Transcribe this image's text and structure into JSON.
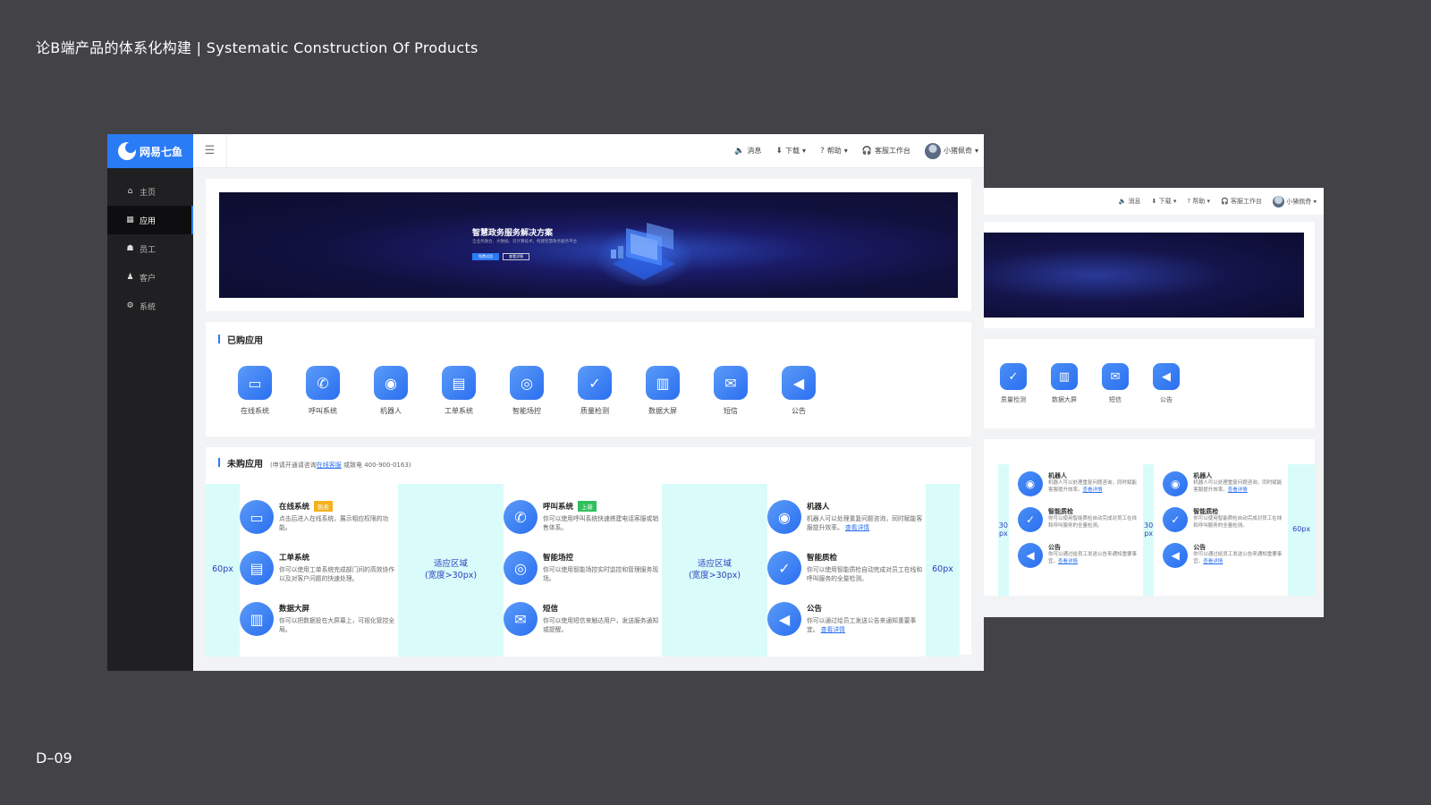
{
  "slide": {
    "title": "论B端产品的体系化构建 | Systematic Construction Of Products",
    "code": "D–09"
  },
  "colors": {
    "primary": "#2a7bf6",
    "sidebar": "#202022",
    "padding_zone": "#d9fcfa",
    "hot_badge": "#f5b21d",
    "new_badge": "#2fbf5b"
  },
  "app": {
    "logo": "网易七鱼",
    "sidebar": [
      {
        "label": "主页",
        "icon": "home-icon"
      },
      {
        "label": "应用",
        "icon": "grid-icon",
        "active": true
      },
      {
        "label": "员工",
        "icon": "team-icon"
      },
      {
        "label": "客户",
        "icon": "user-icon"
      },
      {
        "label": "系统",
        "icon": "gear-icon"
      }
    ],
    "topbar": {
      "message": "消息",
      "download": "下载",
      "help": "帮助",
      "workbench": "客服工作台",
      "username": "小猪佩奇"
    },
    "banner": {
      "title": "智慧政务服务解决方案",
      "subtitle": "全业务融合、大数据、云计算技术，构建智慧政务服务平台",
      "primary_button": "免费试用",
      "secondary_button": "查看详情"
    },
    "purchased": {
      "title": "已购应用",
      "apps": [
        {
          "label": "在线系统",
          "icon": "chat-icon"
        },
        {
          "label": "呼叫系统",
          "icon": "phone-icon"
        },
        {
          "label": "机器人",
          "icon": "robot-icon"
        },
        {
          "label": "工单系统",
          "icon": "ticket-icon"
        },
        {
          "label": "智能场控",
          "icon": "camera-icon"
        },
        {
          "label": "质量检测",
          "icon": "clipboard-icon"
        },
        {
          "label": "数据大屏",
          "icon": "chart-icon"
        },
        {
          "label": "短信",
          "icon": "mail-icon"
        },
        {
          "label": "公告",
          "icon": "megaphone-icon"
        }
      ]
    },
    "unpurchased": {
      "title": "未购应用",
      "hint_prefix": "(申请开通请咨询",
      "hint_link": "在线客服",
      "hint_suffix": "或致电 400-900-0163)",
      "edge_label": "60px",
      "mid_label": "适应区域\n(宽度>30px)",
      "columns": [
        [
          {
            "title": "在线系统",
            "badge": "热卖",
            "badge_color": "#f5b21d",
            "desc": "点击后进入在线系统，展示相应权限的功能。",
            "icon": "chat-icon"
          },
          {
            "title": "工单系统",
            "desc": "你可以使用工单系统完成部门间的高效协作以及对客户问题的快速处理。",
            "icon": "ticket-icon"
          },
          {
            "title": "数据大屏",
            "desc": "你可以把数据投在大屏幕上，可视化管控全局。",
            "icon": "chart-icon"
          }
        ],
        [
          {
            "title": "呼叫系统",
            "badge": "上新",
            "badge_color": "#2fbf5b",
            "desc": "你可以使用呼叫系统快速搭建电话客服或销售体系。",
            "icon": "phone-icon"
          },
          {
            "title": "智能场控",
            "desc": "你可以使用智能场控实时监控和管理服务现场。",
            "icon": "camera-icon"
          },
          {
            "title": "短信",
            "desc": "你可以使用短信来触达用户，发送服务通知或提醒。",
            "icon": "mail-icon"
          }
        ],
        [
          {
            "title": "机器人",
            "desc": "机器人可以处理重复问题咨询，同时赋能客服提升效率。",
            "link": "查看详情",
            "icon": "robot-icon"
          },
          {
            "title": "智能质检",
            "desc": "你可以使用智能质检自动完成对员工在线和呼叫服务的全量检测。",
            "icon": "clipboard-icon"
          },
          {
            "title": "公告",
            "desc": "你可以通过给员工发送公告来通知重要事宜。",
            "link": "查看详情",
            "icon": "megaphone-icon"
          }
        ]
      ]
    }
  },
  "back_screen": {
    "topbar": {
      "message": "消息",
      "download": "下载",
      "help": "帮助",
      "workbench": "客服工作台",
      "username": "小猪佩奇"
    },
    "apps": [
      {
        "label": "质量检测",
        "icon": "clipboard-icon"
      },
      {
        "label": "数据大屏",
        "icon": "chart-icon"
      },
      {
        "label": "短信",
        "icon": "mail-icon"
      },
      {
        "label": "公告",
        "icon": "megaphone-icon"
      }
    ],
    "left_pad_label": "30\npx",
    "right_pad_label": "60px",
    "items": [
      {
        "title": "机器人",
        "desc": "机器人可以处理重复问题咨询，同时赋能客服提升效率。",
        "link": "查看详情",
        "icon": "robot-icon"
      },
      {
        "title": "智能质检",
        "desc": "你可以使用智能质检自动完成对员工在线和呼叫服务的全量检测。",
        "icon": "clipboard-icon"
      },
      {
        "title": "公告",
        "desc": "你可以通过给员工发送公告来通知重要事宜。",
        "link": "查看详情",
        "icon": "megaphone-icon"
      }
    ]
  }
}
